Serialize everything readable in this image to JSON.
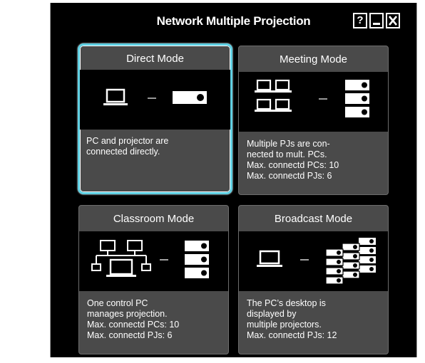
{
  "window": {
    "title": "Network Multiple Projection",
    "help_button": "?",
    "minimize_button": "",
    "close_button": ""
  },
  "modes": [
    {
      "title": "Direct Mode",
      "selected": true,
      "description": [
        "PC and projector are",
        "connected directly."
      ]
    },
    {
      "title": "Meeting Mode",
      "selected": false,
      "description": [
        "Multiple PJs are con-",
        "nected to mult. PCs.",
        "Max. connectd PCs: 10",
        "Max. connectd PJs: 6"
      ]
    },
    {
      "title": "Classroom Mode",
      "selected": false,
      "description": [
        "One control PC",
        "manages projection.",
        "Max. connectd PCs: 10",
        "Max. connectd PJs: 6"
      ]
    },
    {
      "title": "Broadcast Mode",
      "selected": false,
      "description": [
        "The PC’s desktop is",
        "displayed by",
        "multiple projectors.",
        "Max. connectd PJs: 12"
      ]
    }
  ],
  "colors": {
    "selection_border": "#5fd0e3",
    "card_background": "#4a4a4a",
    "window_background": "#000000"
  }
}
